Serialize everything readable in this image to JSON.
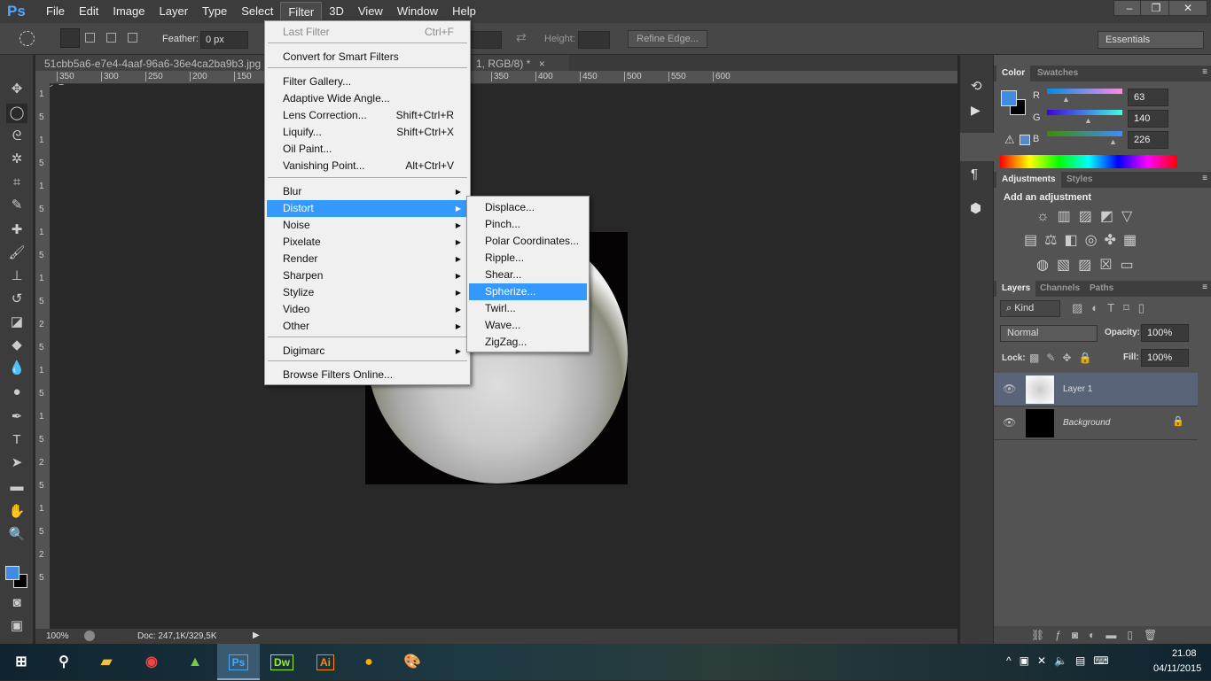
{
  "app": {
    "logo": "Ps",
    "window_controls": [
      "–",
      "❐",
      "✕"
    ]
  },
  "menubar": [
    "File",
    "Edit",
    "Image",
    "Layer",
    "Type",
    "Select",
    "Filter",
    "3D",
    "View",
    "Window",
    "Help"
  ],
  "options": {
    "feather_label": "Feather:",
    "feather_value": "0 px",
    "height_label": "Height:",
    "refine_edge": "Refine Edge...",
    "workspace": "Essentials"
  },
  "document": {
    "tab1": "51cbb5a6-e7e4-4aaf-96a6-36e4ca2ba9b3.jpg @ 1",
    "tab1_suffix": "1, RGB/8) *",
    "close": "×"
  },
  "ruler_h": [
    "350",
    "300",
    "250",
    "200",
    "150",
    "150",
    "200",
    "250",
    "300",
    "350",
    "400",
    "450",
    "500",
    "550",
    "600"
  ],
  "ruler_v": [
    "1",
    "5",
    "1",
    "5",
    "1",
    "5",
    "1",
    "5",
    "1",
    "5",
    "2",
    "5",
    "1",
    "5",
    "1",
    "5",
    "2",
    "5",
    "1",
    "5",
    "2",
    "5"
  ],
  "status": {
    "zoom": "100%",
    "doc": "Doc: 247,1K/329,5K"
  },
  "filter_menu": {
    "items": [
      {
        "label": "Last Filter",
        "shortcut": "Ctrl+F",
        "disabled": true
      },
      {
        "label": "Convert for Smart Filters"
      },
      {
        "label": "Filter Gallery..."
      },
      {
        "label": "Adaptive Wide Angle..."
      },
      {
        "label": "Lens Correction...",
        "shortcut": "Shift+Ctrl+R"
      },
      {
        "label": "Liquify...",
        "shortcut": "Shift+Ctrl+X"
      },
      {
        "label": "Oil Paint..."
      },
      {
        "label": "Vanishing Point...",
        "shortcut": "Alt+Ctrl+V"
      },
      {
        "label": "Blur",
        "submenu": true
      },
      {
        "label": "Distort",
        "submenu": true,
        "highlighted": true
      },
      {
        "label": "Noise",
        "submenu": true
      },
      {
        "label": "Pixelate",
        "submenu": true
      },
      {
        "label": "Render",
        "submenu": true
      },
      {
        "label": "Sharpen",
        "submenu": true
      },
      {
        "label": "Stylize",
        "submenu": true
      },
      {
        "label": "Video",
        "submenu": true
      },
      {
        "label": "Other",
        "submenu": true
      },
      {
        "label": "Digimarc",
        "submenu": true
      },
      {
        "label": "Browse Filters Online..."
      }
    ]
  },
  "distort_submenu": [
    "Displace...",
    "Pinch...",
    "Polar Coordinates...",
    "Ripple...",
    "Shear...",
    "Spherize...",
    "Twirl...",
    "Wave...",
    "ZigZag..."
  ],
  "distort_highlighted": "Spherize...",
  "color_panel": {
    "tabs": [
      "Color",
      "Swatches"
    ],
    "r_label": "R",
    "g_label": "G",
    "b_label": "B",
    "r": "63",
    "g": "140",
    "b": "226",
    "foreground": "#3f8ce2",
    "background": "#000000"
  },
  "adjustments_panel": {
    "tabs": [
      "Adjustments",
      "Styles"
    ],
    "heading": "Add an adjustment"
  },
  "layers_panel": {
    "tabs": [
      "Layers",
      "Channels",
      "Paths"
    ],
    "kind": "Kind",
    "blend": "Normal",
    "opacity_label": "Opacity:",
    "opacity": "100%",
    "lock_label": "Lock:",
    "fill_label": "Fill:",
    "fill": "100%",
    "layers": [
      {
        "name": "Layer 1",
        "selected": true
      },
      {
        "name": "Background",
        "locked": true
      }
    ]
  },
  "taskbar": {
    "apps": [
      "Ps",
      "Dw",
      "Ai"
    ],
    "time": "21.08",
    "date": "04/11/2015"
  }
}
